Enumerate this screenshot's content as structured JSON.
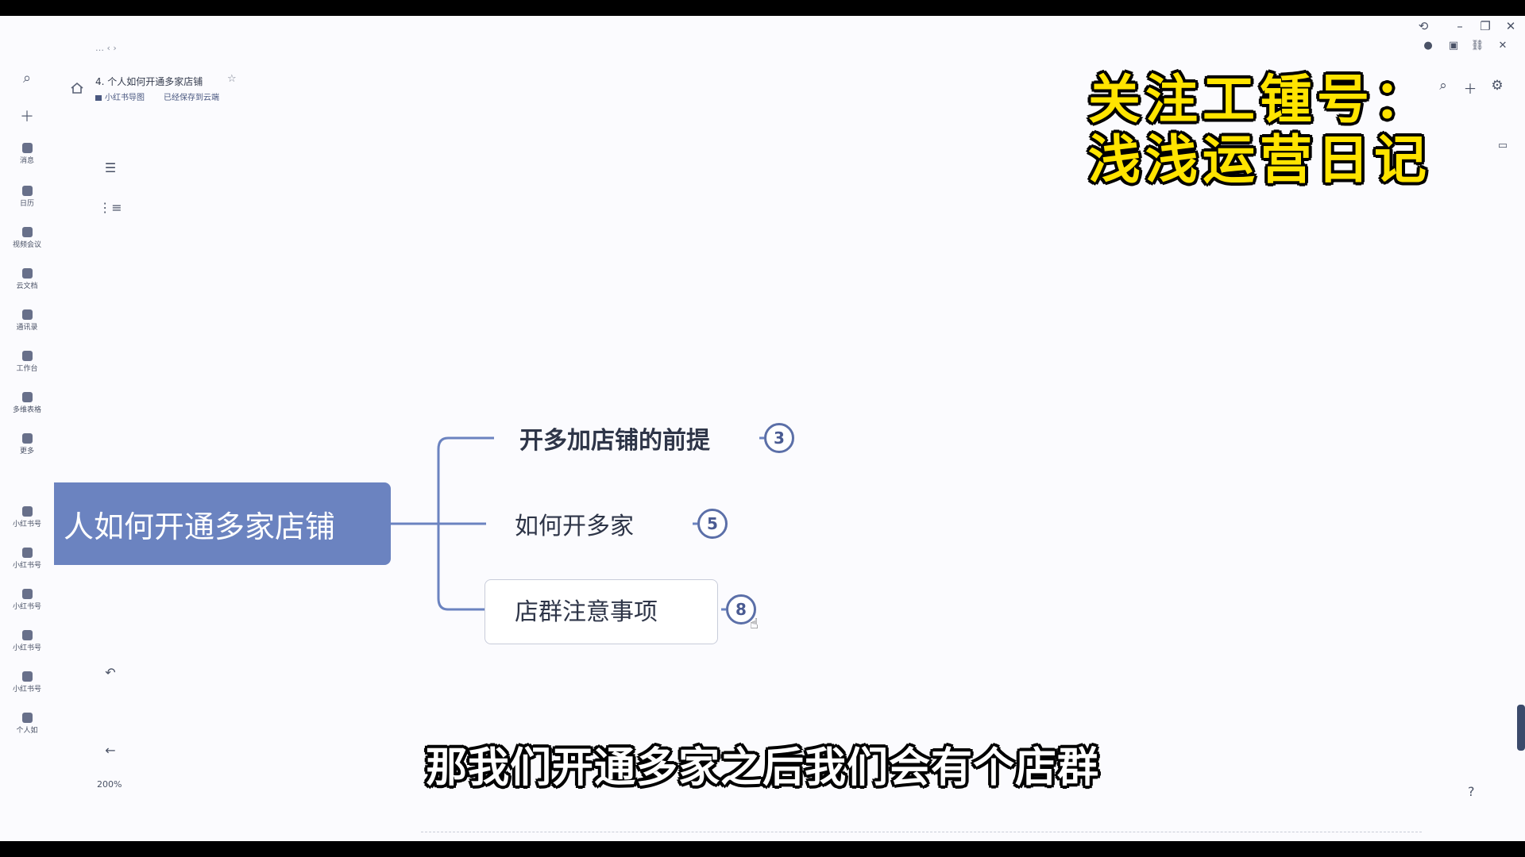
{
  "doc": {
    "collapse_label": "… ‹ ›",
    "title": "4. 个人如何开通多家店铺",
    "folder": "小红书导图",
    "status": "已经保存到云端"
  },
  "rail": {
    "items": [
      {
        "label": "消息",
        "icon": "chat-icon"
      },
      {
        "label": "日历",
        "icon": "calendar-icon"
      },
      {
        "label": "视频会议",
        "icon": "video-icon"
      },
      {
        "label": "云文档",
        "icon": "docs-icon"
      },
      {
        "label": "通讯录",
        "icon": "contacts-icon"
      },
      {
        "label": "工作台",
        "icon": "apps-icon"
      },
      {
        "label": "多维表格",
        "icon": "table-icon"
      },
      {
        "label": "更多",
        "icon": "more-icon"
      },
      {
        "label": "小红书号",
        "icon": "app-icon"
      },
      {
        "label": "小红书号",
        "icon": "app-icon"
      },
      {
        "label": "小红书号",
        "icon": "app-icon"
      },
      {
        "label": "小红书号",
        "icon": "app-icon"
      },
      {
        "label": "小红书号",
        "icon": "app-icon"
      },
      {
        "label": "个人如",
        "icon": "app-icon"
      }
    ]
  },
  "zoom": "200%",
  "watermark": {
    "line1": "关注工锺号：",
    "line2": "浅浅运营日记"
  },
  "mindmap": {
    "root": "人如何开通多家店铺",
    "branches": [
      {
        "label": "开多加店铺的前提",
        "count": "3"
      },
      {
        "label": "如何开多家",
        "count": "5"
      },
      {
        "label": "店群注意事项",
        "count": "8"
      }
    ]
  },
  "subtitle": "那我们开通多家之后我们会有个店群",
  "colors": {
    "root_fill": "#6b83c0",
    "badge_border": "#5b6fa8",
    "watermark": "#ffe400"
  }
}
